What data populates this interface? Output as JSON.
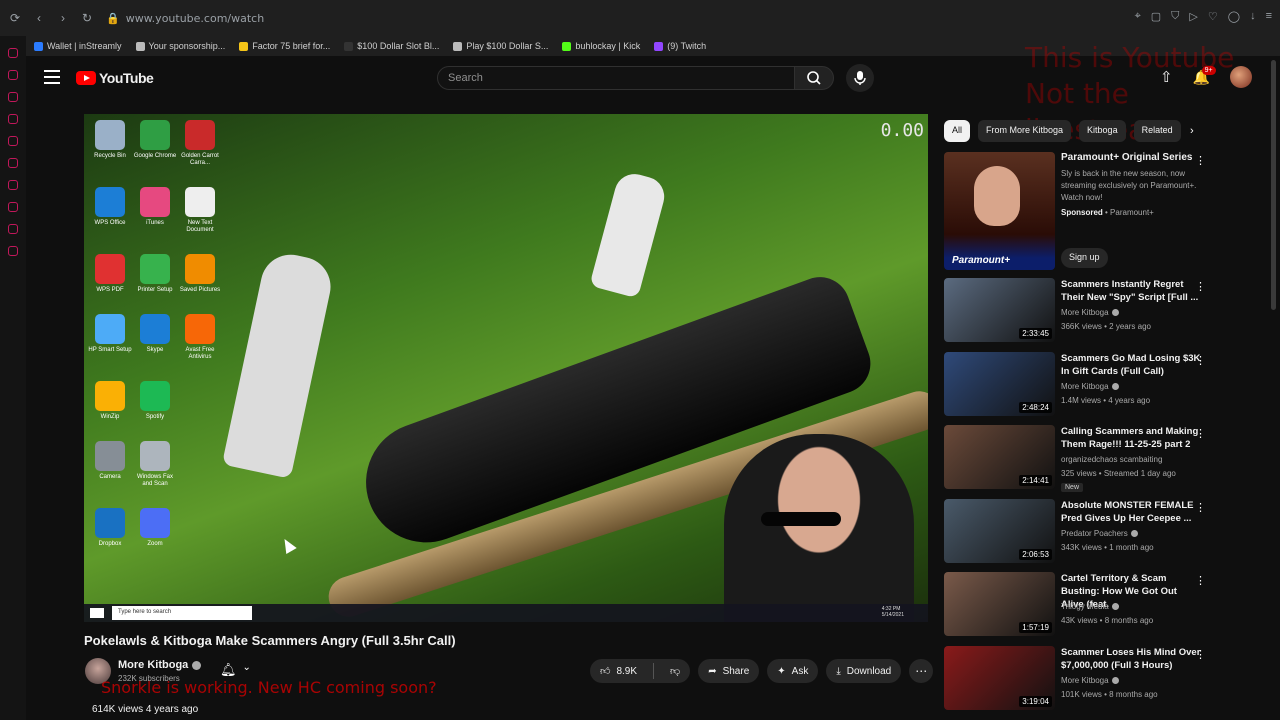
{
  "browser": {
    "url": "www.youtube.com/watch",
    "bookmarks": [
      {
        "label": "Wallet | inStreamly",
        "color": "#2b7cff"
      },
      {
        "label": "Your sponsorship...",
        "color": "#bbbbbb"
      },
      {
        "label": "Factor 75 brief for...",
        "color": "#f5c518"
      },
      {
        "label": "$100 Dollar Slot Bl...",
        "color": "#333333"
      },
      {
        "label": "Play $100 Dollar S...",
        "color": "#bbbbbb"
      },
      {
        "label": "buhlockay | Kick",
        "color": "#53fc18"
      },
      {
        "label": "(9) Twitch",
        "color": "#9146ff"
      }
    ]
  },
  "header": {
    "logo_text": "YouTube",
    "search_placeholder": "Search",
    "notification_count": "9+",
    "overlay_line1": "This is Youtube",
    "overlay_line2": "Not the livestream"
  },
  "player": {
    "timer": "0.00",
    "desktop_icons": [
      {
        "label": "Recycle Bin",
        "color": "#9ab0c8"
      },
      {
        "label": "Google Chrome",
        "color": "#2f9e44"
      },
      {
        "label": "Golden Carrot Carra...",
        "color": "#c92a2a"
      },
      {
        "label": "WPS Office",
        "color": "#1c7ed6"
      },
      {
        "label": "iTunes",
        "color": "#e64980"
      },
      {
        "label": "New Text Document",
        "color": "#eeeeee"
      },
      {
        "label": "WPS PDF",
        "color": "#e03131"
      },
      {
        "label": "Printer Setup",
        "color": "#37b24d"
      },
      {
        "label": "Saved Pictures",
        "color": "#f08c00"
      },
      {
        "label": "HP Smart Setup",
        "color": "#4dabf7"
      },
      {
        "label": "Skype",
        "color": "#1c7ed6"
      },
      {
        "label": "Avast Free Antivirus",
        "color": "#f76707"
      },
      {
        "label": "WinZip",
        "color": "#fab005"
      },
      {
        "label": "Spotify",
        "color": "#1db954"
      },
      {
        "label": "",
        "color": "transparent"
      },
      {
        "label": "Camera",
        "color": "#868e96"
      },
      {
        "label": "Windows Fax and Scan",
        "color": "#adb5bd"
      },
      {
        "label": "",
        "color": "transparent"
      },
      {
        "label": "Dropbox",
        "color": "#1971c2"
      },
      {
        "label": "Zoom",
        "color": "#4c6ef5"
      }
    ],
    "taskbar_search": "Type here to search",
    "clock_time": "4:32 PM",
    "clock_date": "5/14/2021"
  },
  "video": {
    "title": "Pokelawls & Kitboga Make Scammers Angry (Full 3.5hr Call)",
    "channel": "More Kitboga",
    "subscribers": "232K subscribers",
    "overlay_text": "Snorkle is working. New HC coming soon?",
    "views_date": "614K views  4 years ago",
    "likes": "8.9K",
    "share_label": "Share",
    "ask_label": "Ask",
    "download_label": "Download"
  },
  "chips": [
    "All",
    "From More Kitboga",
    "Kitboga",
    "Related"
  ],
  "ad": {
    "title": "Paramount+ Original Series",
    "description": "Sly is back in the new season, now streaming exclusively on Paramount+. Watch now!",
    "sponsored": "Sponsored",
    "advertiser": "• Paramount+",
    "cta": "Sign up",
    "brand": "Paramount+"
  },
  "recommendations": [
    {
      "title": "Scammers Instantly Regret Their New \"Spy\" Script [Full ...",
      "channel": "More Kitboga",
      "verified": true,
      "meta": "366K views • 2 years ago",
      "duration": "2:33:45",
      "badge": "",
      "thumb": "#5b6b80"
    },
    {
      "title": "Scammers Go Mad Losing $3K In Gift Cards (Full Call)",
      "channel": "More Kitboga",
      "verified": true,
      "meta": "1.4M views • 4 years ago",
      "duration": "2:48:24",
      "badge": "",
      "thumb": "#2f4a7a"
    },
    {
      "title": "Calling Scammers and Making Them Rage!!! 11-25-25 part 2",
      "channel": "organizedchaos scambaiting",
      "verified": false,
      "meta": "325 views • Streamed 1 day ago",
      "duration": "2:14:41",
      "badge": "New",
      "thumb": "#6b4a3a"
    },
    {
      "title": "Absolute MONSTER FEMALE Pred Gives Up Her Ceepee ...",
      "channel": "Predator Poachers",
      "verified": true,
      "meta": "343K views • 1 month ago",
      "duration": "2:06:53",
      "badge": "",
      "thumb": "#4a5a6a"
    },
    {
      "title": "Cartel Territory & Scam Busting: How We Got Out Alive (feat. ...",
      "channel": "Trilogy Media",
      "verified": true,
      "meta": "43K views • 8 months ago",
      "duration": "1:57:19",
      "badge": "",
      "thumb": "#7a5a4a"
    },
    {
      "title": "Scammer Loses His Mind Over $7,000,000 (Full 3 Hours)",
      "channel": "More Kitboga",
      "verified": true,
      "meta": "101K views • 8 months ago",
      "duration": "3:19:04",
      "badge": "",
      "thumb": "#8a1a1a"
    }
  ]
}
